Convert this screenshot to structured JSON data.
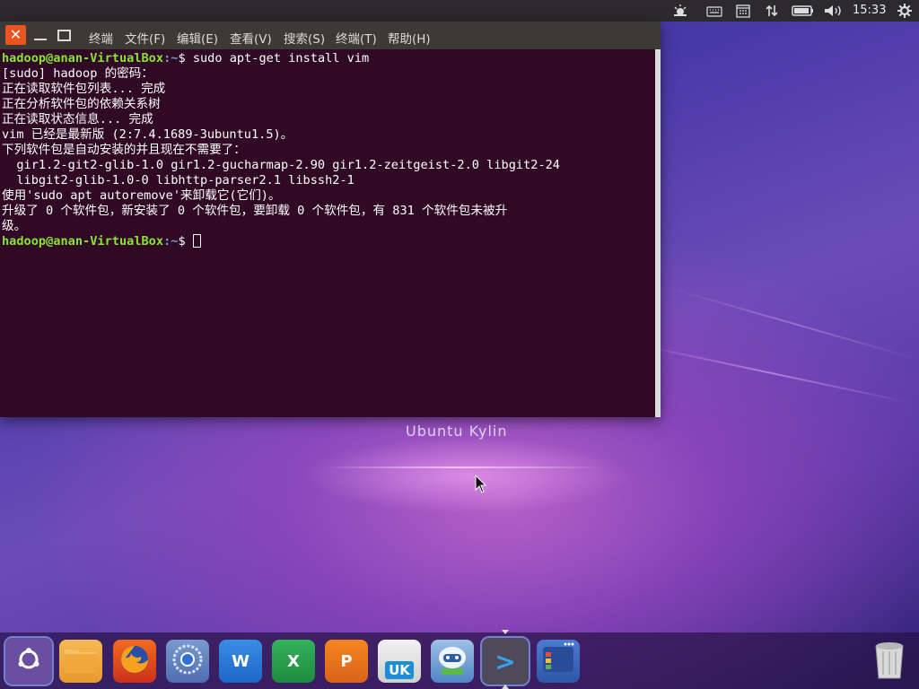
{
  "top_panel": {
    "clock": "15:33",
    "tray_icons": [
      "weather-icon",
      "keyboard-icon",
      "calendar-icon",
      "network-arrows-icon",
      "battery-icon",
      "volume-icon",
      "settings-gear-icon"
    ]
  },
  "terminal": {
    "menu": [
      "终端",
      "文件(F)",
      "编辑(E)",
      "查看(V)",
      "搜索(S)",
      "终端(T)",
      "帮助(H)"
    ],
    "prompt_user": "hadoop@anan-VirtualBox",
    "prompt_path": ":~",
    "prompt_symbol": "$ ",
    "command": "sudo apt-get install vim",
    "output_lines": [
      "[sudo] hadoop 的密码：",
      "正在读取软件包列表... 完成",
      "正在分析软件包的依赖关系树",
      "正在读取状态信息... 完成",
      "vim 已经是最新版 (2:7.4.1689-3ubuntu1.5)。",
      "下列软件包是自动安装的并且现在不需要了：",
      "  gir1.2-git2-glib-1.0 gir1.2-gucharmap-2.90 gir1.2-zeitgeist-2.0 libgit2-24",
      "  libgit2-glib-1.0-0 libhttp-parser2.1 libssh2-1",
      "使用'sudo apt autoremove'来卸载它(它们)。",
      "升级了 0 个软件包，新安装了 0 个软件包，要卸载 0 个软件包，有 831 个软件包未被升",
      "级。"
    ]
  },
  "desktop": {
    "label": "Ubuntu Kylin"
  },
  "dock": {
    "items": [
      {
        "name": "ubuntu-logo",
        "label": ""
      },
      {
        "name": "files",
        "label": ""
      },
      {
        "name": "firefox",
        "label": ""
      },
      {
        "name": "chromium",
        "label": ""
      },
      {
        "name": "wps-writer",
        "label": "W"
      },
      {
        "name": "wps-spreadsheets",
        "label": "X"
      },
      {
        "name": "wps-presentation",
        "label": "P"
      },
      {
        "name": "software-center",
        "label": "UK"
      },
      {
        "name": "assistant",
        "label": ""
      },
      {
        "name": "terminal",
        "label": ">"
      },
      {
        "name": "workspaces",
        "label": ""
      },
      {
        "name": "trash",
        "label": ""
      }
    ]
  }
}
